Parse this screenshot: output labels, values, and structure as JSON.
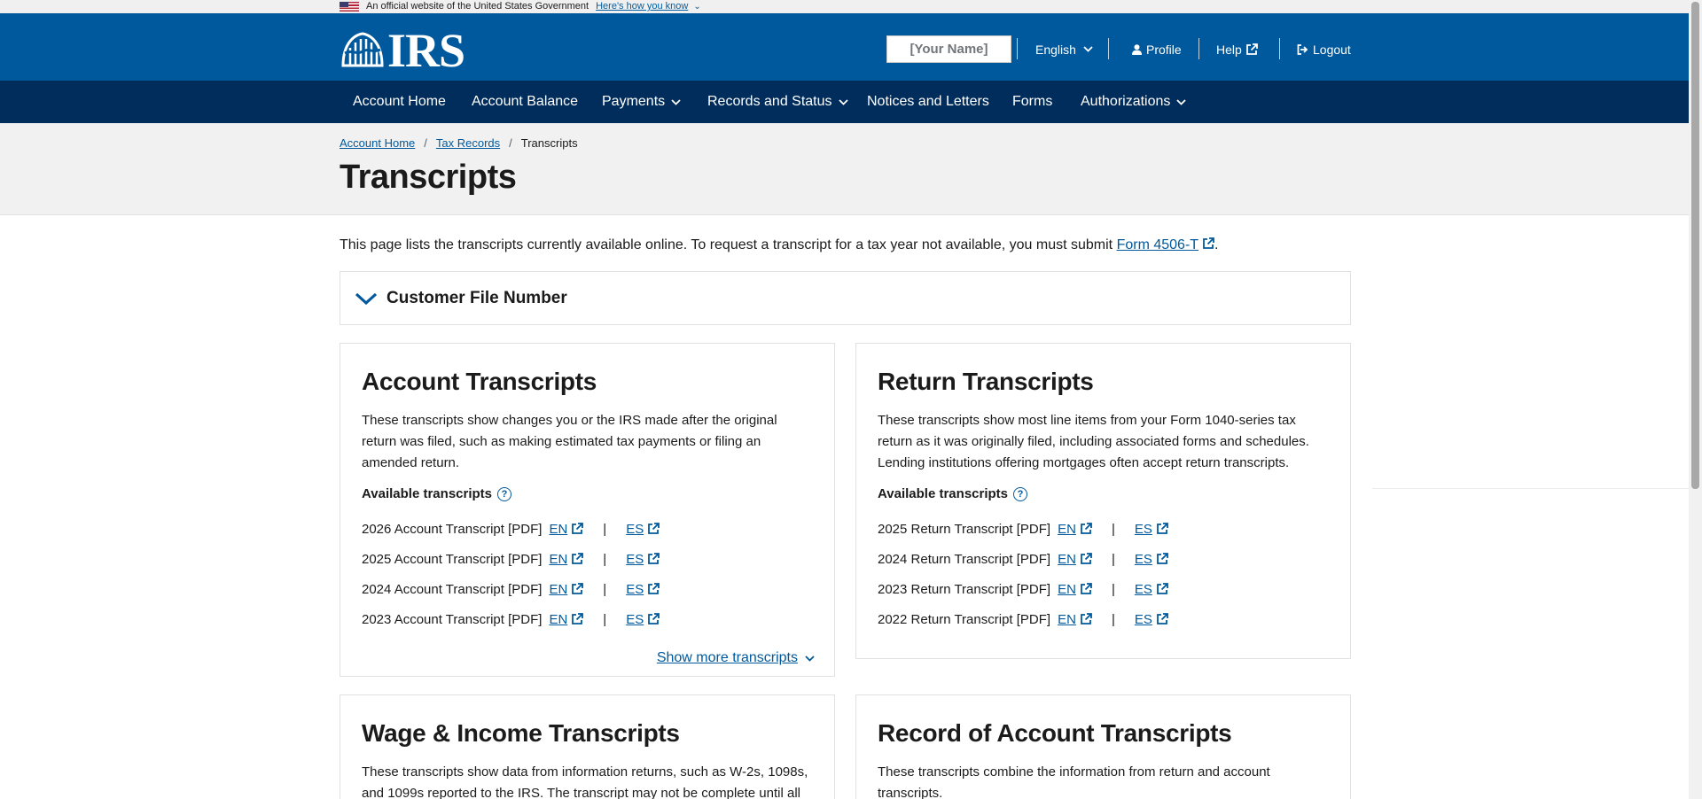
{
  "gov_banner": {
    "text": "An official website of the United States Government",
    "link": "Here's how you know"
  },
  "header": {
    "logo_text": "IRS",
    "name_placeholder": "[Your Name]",
    "language": "English",
    "profile": "Profile",
    "help": "Help",
    "logout": "Logout"
  },
  "nav": {
    "items": [
      "Account Home",
      "Account Balance",
      "Payments",
      "Records and Status",
      "Notices and Letters",
      "Forms",
      "Authorizations"
    ]
  },
  "breadcrumb": {
    "home": "Account Home",
    "tax_records": "Tax Records",
    "current": "Transcripts"
  },
  "page": {
    "title": "Transcripts",
    "intro_text": "This page lists the transcripts currently available online. To request a transcript for a tax year not available, you must submit ",
    "intro_link": "Form 4506-T",
    "intro_end": "."
  },
  "accordion": {
    "label": "Customer File Number"
  },
  "cards": {
    "account": {
      "title": "Account Transcripts",
      "description": "These transcripts show changes you or the IRS made after the original return was filed, such as making estimated tax payments or filing an amended return.",
      "available_label": "Available transcripts",
      "rows": [
        "2026 Account Transcript [PDF]",
        "2025 Account Transcript [PDF]",
        "2024 Account Transcript [PDF]",
        "2023 Account Transcript [PDF]"
      ],
      "show_more": "Show more transcripts"
    },
    "return": {
      "title": "Return Transcripts",
      "description": "These transcripts show most line items from your Form 1040-series tax return as it was originally filed, including associated forms and schedules. Lending institutions offering mortgages often accept return transcripts.",
      "available_label": "Available transcripts",
      "rows": [
        "2025 Return Transcript [PDF]",
        "2024 Return Transcript [PDF]",
        "2023 Return Transcript [PDF]",
        "2022 Return Transcript [PDF]"
      ]
    },
    "wage": {
      "title": "Wage & Income Transcripts",
      "description": "These transcripts show data from information returns, such as W-2s, 1098s, and 1099s reported to the IRS. The transcript may not be complete until all"
    },
    "record": {
      "title": "Record of Account Transcripts",
      "description": "These transcripts combine the information from return and account transcripts."
    }
  },
  "labels": {
    "en": "EN",
    "es": "ES",
    "divider": "|",
    "help_q": "?"
  },
  "colors": {
    "header_blue": "#00599c",
    "nav_navy": "#002d5b",
    "link": "#00599c"
  }
}
